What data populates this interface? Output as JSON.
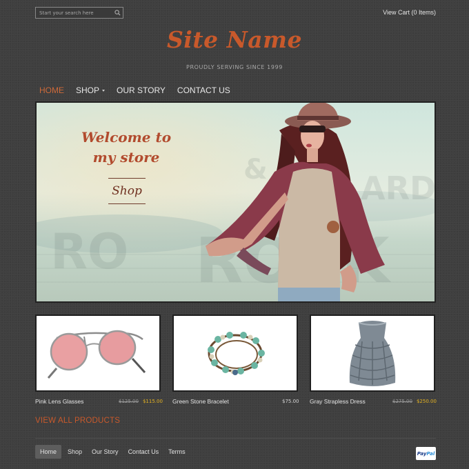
{
  "header": {
    "search_placeholder": "Start your search here",
    "cart_label": "View Cart (0 Items)",
    "site_name": "Site Name",
    "tagline": "PROUDLY SERVING SINCE 1999"
  },
  "nav": {
    "items": [
      {
        "label": "HOME",
        "active": true
      },
      {
        "label": "SHOP",
        "has_dropdown": true
      },
      {
        "label": "OUR STORY"
      },
      {
        "label": "CONTACT US"
      }
    ]
  },
  "hero": {
    "headline": "Welcome to my store",
    "cta_label": "Shop"
  },
  "products": [
    {
      "name": "Pink Lens Glasses",
      "old_price": "$125.00",
      "price": "$115.00",
      "on_sale": true,
      "icon": "sunglasses-image"
    },
    {
      "name": "Green Stone Bracelet",
      "price": "$75.00",
      "on_sale": false,
      "icon": "bracelet-image"
    },
    {
      "name": "Gray Strapless Dress",
      "old_price": "$275.00",
      "price": "$250.00",
      "on_sale": true,
      "icon": "dress-image"
    }
  ],
  "view_all_label": "VIEW ALL PRODUCTS",
  "footer": {
    "links": [
      {
        "label": "Home",
        "active": true
      },
      {
        "label": "Shop"
      },
      {
        "label": "Our Story"
      },
      {
        "label": "Contact Us"
      },
      {
        "label": "Terms"
      }
    ],
    "paypal_part1": "Pay",
    "paypal_part2": "Pal"
  },
  "colors": {
    "accent": "#c8592b",
    "sale_price": "#e5b322",
    "background": "#3f3f3f"
  }
}
